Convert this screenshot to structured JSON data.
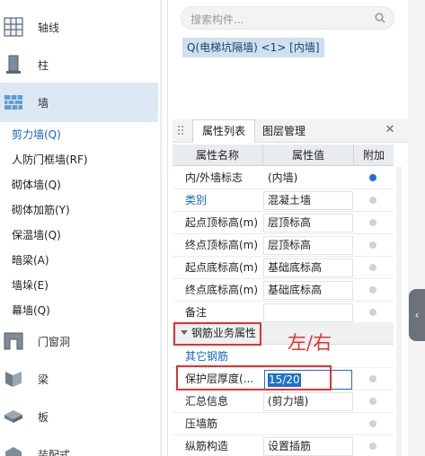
{
  "nav": {
    "categories": [
      {
        "label": "轴线",
        "icon": "grid-axis-icon"
      },
      {
        "label": "柱",
        "icon": "column-icon"
      },
      {
        "label": "墙",
        "icon": "wall-icon"
      },
      {
        "label": "门窗洞",
        "icon": "door-window-icon"
      },
      {
        "label": "梁",
        "icon": "beam-icon"
      },
      {
        "label": "板",
        "icon": "slab-icon"
      },
      {
        "label": "装配式",
        "icon": "prefab-icon"
      }
    ],
    "wall_items": [
      "剪力墙(Q)",
      "人防门框墙(RF)",
      "砌体墙(Q)",
      "砌体加筋(Y)",
      "保温墙(Q)",
      "暗梁(A)",
      "墙垛(E)",
      "幕墙(Q)"
    ]
  },
  "search": {
    "placeholder": "搜索构件..."
  },
  "selected_component": "Q(电梯坑隔墙) <1> [内墙]",
  "tabs": {
    "properties": "属性列表",
    "layers": "图层管理"
  },
  "table": {
    "headers": [
      "属性名称",
      "属性值",
      "附加"
    ],
    "rows": [
      {
        "name": "内/外墙标志",
        "value": "(内墙)",
        "checked": true
      },
      {
        "name": "类别",
        "value": "混凝土墙",
        "link": true
      },
      {
        "name": "起点顶标高(m)",
        "value": "层顶标高"
      },
      {
        "name": "终点顶标高(m)",
        "value": "层顶标高"
      },
      {
        "name": "起点底标高(m)",
        "value": "基础底标高"
      },
      {
        "name": "终点底标高(m)",
        "value": "基础底标高"
      },
      {
        "name": "备注",
        "value": ""
      }
    ],
    "group": "钢筋业务属性",
    "group_rows": [
      {
        "name": "其它钢筋",
        "value": "",
        "link": true
      },
      {
        "name": "保护层厚度(...",
        "value": "15/20",
        "editing": true
      },
      {
        "name": "汇总信息",
        "value": "(剪力墙)"
      },
      {
        "name": "压墙筋",
        "value": ""
      },
      {
        "name": "纵筋构造",
        "value": "设置插筋"
      }
    ]
  },
  "annotation": "左/右",
  "colors": {
    "accent": "#1e6fd0",
    "highlight": "#e53030",
    "active_nav_bg": "#dce8f3"
  }
}
